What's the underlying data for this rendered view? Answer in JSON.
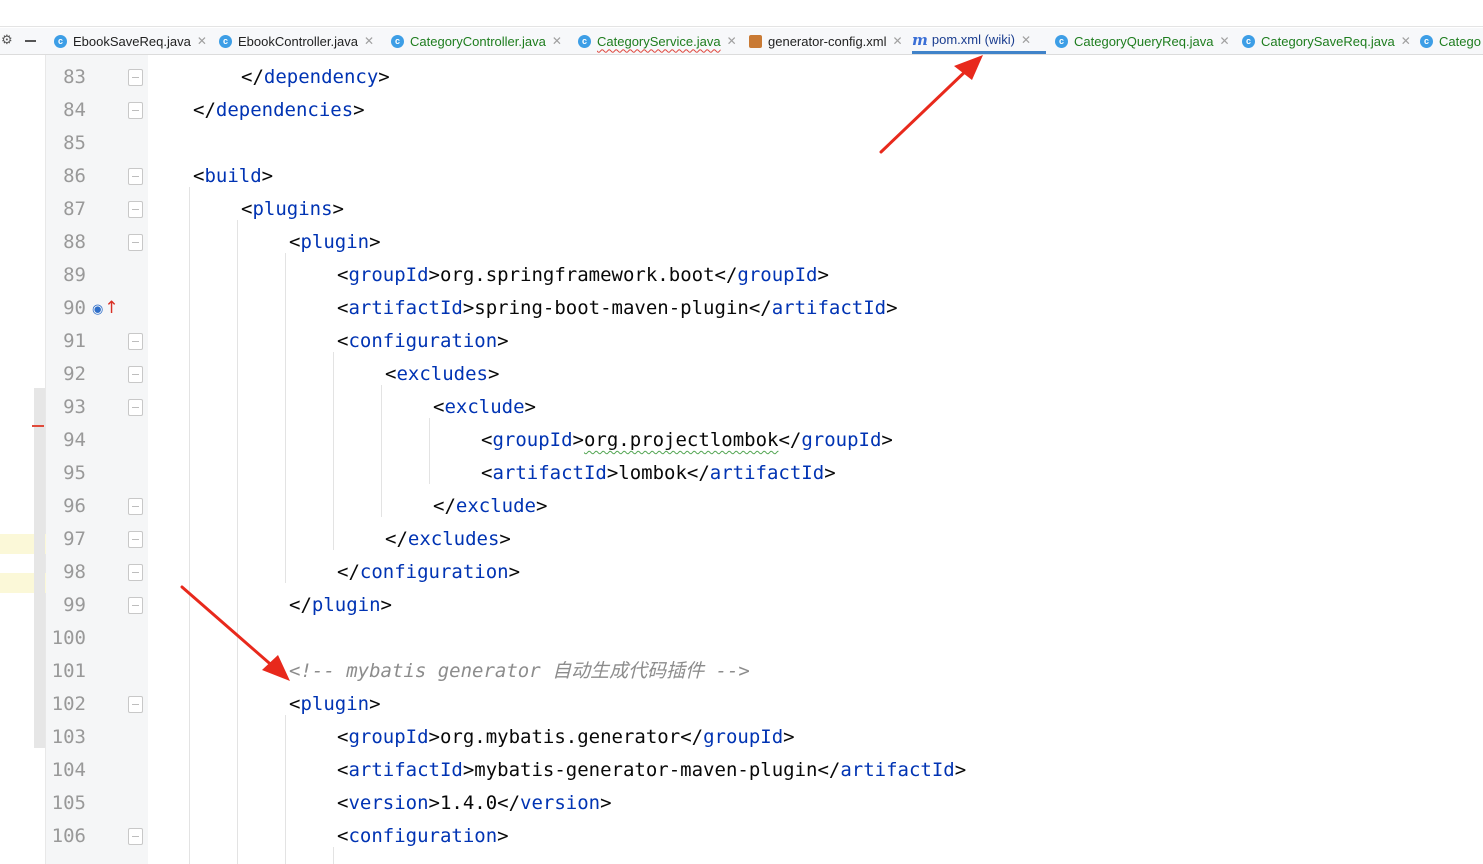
{
  "tabs": [
    {
      "label": "EbookSaveReq.java",
      "icon": "java-class-icon",
      "style": "normal"
    },
    {
      "label": "EbookController.java",
      "icon": "java-class-icon",
      "style": "normal"
    },
    {
      "label": "CategoryController.java",
      "icon": "java-class-icon",
      "style": "green"
    },
    {
      "label": "CategoryService.java",
      "icon": "java-class-icon",
      "style": "green-error"
    },
    {
      "label": "generator-config.xml",
      "icon": "xml-file-icon",
      "style": "normal"
    },
    {
      "label": "pom.xml (wiki)",
      "icon": "maven-icon",
      "style": "active"
    },
    {
      "label": "CategoryQueryReq.java",
      "icon": "java-class-icon",
      "style": "green"
    },
    {
      "label": "CategorySaveReq.java",
      "icon": "java-class-icon",
      "style": "green"
    },
    {
      "label": "Catego",
      "icon": "java-class-icon",
      "style": "green"
    }
  ],
  "code_lines": [
    {
      "n": "83",
      "code": "</dependency>"
    },
    {
      "n": "84",
      "code": "</dependencies>"
    },
    {
      "n": "85",
      "code": ""
    },
    {
      "n": "86",
      "code": "<build>"
    },
    {
      "n": "87",
      "code": "<plugins>"
    },
    {
      "n": "88",
      "code": "<plugin>"
    },
    {
      "n": "89",
      "code": "<groupId>org.springframework.boot</groupId>"
    },
    {
      "n": "90",
      "code": "<artifactId>spring-boot-maven-plugin</artifactId>"
    },
    {
      "n": "91",
      "code": "<configuration>"
    },
    {
      "n": "92",
      "code": "<excludes>"
    },
    {
      "n": "93",
      "code": "<exclude>"
    },
    {
      "n": "94",
      "code": "<groupId>org.projectlombok</groupId>"
    },
    {
      "n": "95",
      "code": "<artifactId>lombok</artifactId>"
    },
    {
      "n": "96",
      "code": "</exclude>"
    },
    {
      "n": "97",
      "code": "</excludes>"
    },
    {
      "n": "98",
      "code": "</configuration>"
    },
    {
      "n": "99",
      "code": "</plugin>"
    },
    {
      "n": "100",
      "code": ""
    },
    {
      "n": "101",
      "code": "<!-- mybatis generator 自动生成代码插件 -->"
    },
    {
      "n": "102",
      "code": "<plugin>"
    },
    {
      "n": "103",
      "code": "<groupId>org.mybatis.generator</groupId>"
    },
    {
      "n": "104",
      "code": "<artifactId>mybatis-generator-maven-plugin</artifactId>"
    },
    {
      "n": "105",
      "code": "<version>1.4.0</version>"
    },
    {
      "n": "106",
      "code": "<configuration>"
    }
  ],
  "colors": {
    "tag": "#0033b3",
    "text": "#080808",
    "comment": "#8c8c8c",
    "line_number": "#999999",
    "annotation_arrow": "#e8291c"
  }
}
